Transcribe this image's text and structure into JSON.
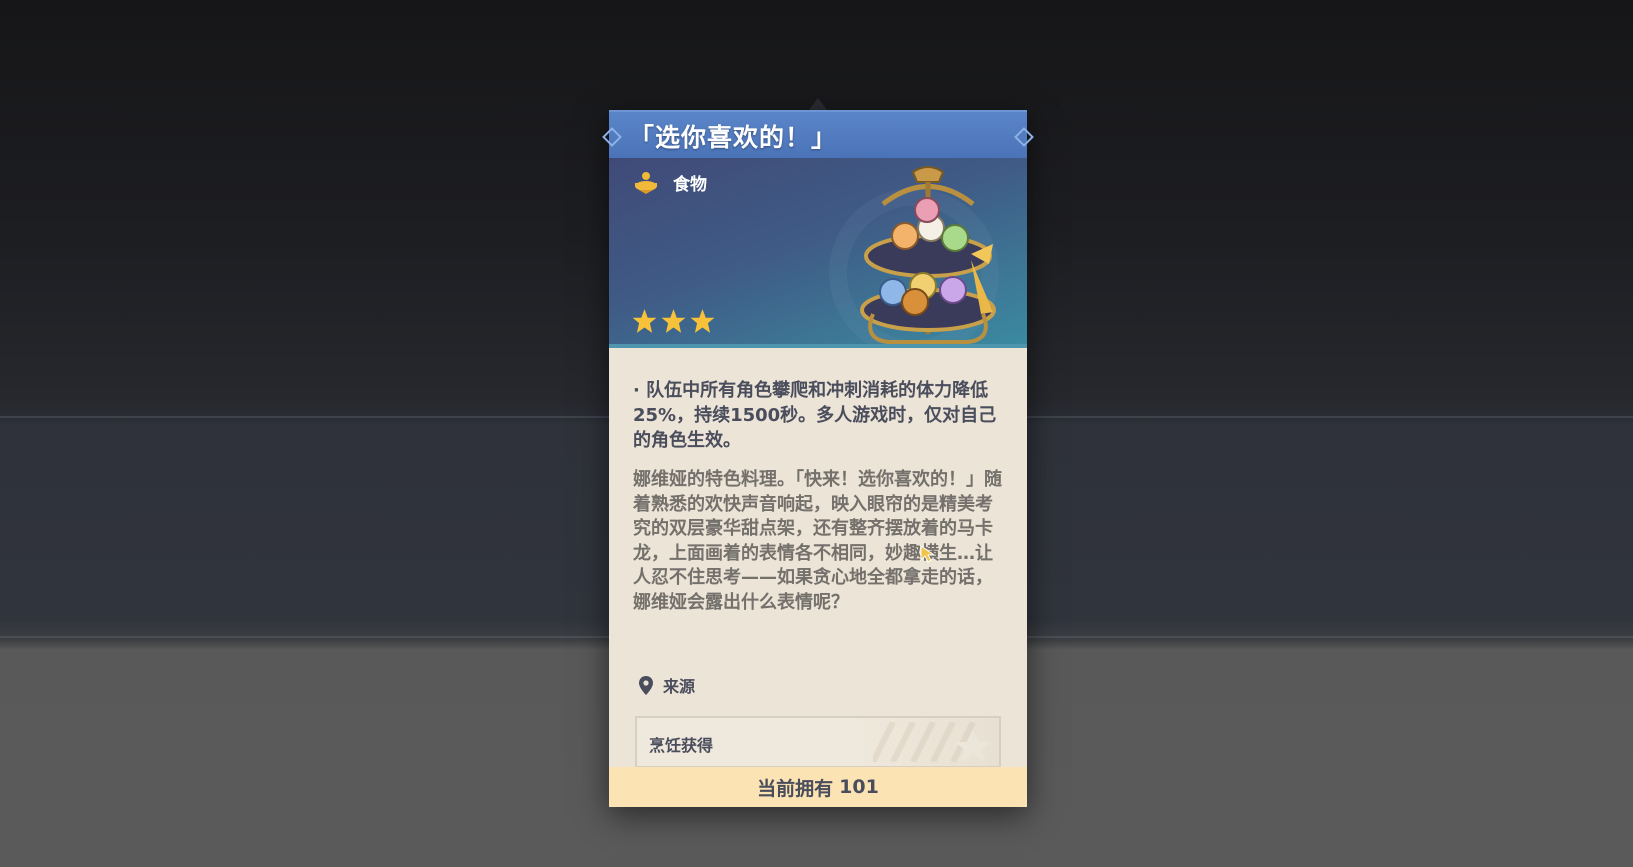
{
  "item": {
    "title": "「选你喜欢的！」",
    "category": "食物",
    "rarity": 3,
    "effect": "· 队伍中所有角色攀爬和冲刺消耗的体力降低25%，持续1500秒。多人游戏时，仅对自己的角色生效。",
    "description": "娜维娅的特色料理。「快来！选你喜欢的！」随着熟悉的欢快声音响起，映入眼帘的是精美考究的双层豪华甜点架，还有整齐摆放着的马卡龙，上面画着的表情各不相同，妙趣横生…让人忍不住思考——如果贪心地全都拿走的话，娜维娅会露出什么表情呢？",
    "source_label": "来源",
    "source_item": "烹饪获得",
    "owned_label": "当前拥有",
    "owned_count": "101"
  },
  "colors": {
    "title_bar": "#5b85c9",
    "star": "#f7c13a",
    "footer": "#fbe3b3",
    "card_body": "#ece4d7"
  },
  "icons": {
    "category": "food-icon",
    "source": "location-pin-icon",
    "star": "star-icon"
  }
}
